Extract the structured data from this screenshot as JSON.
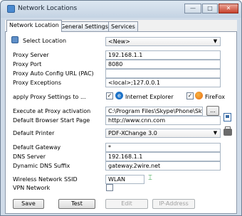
{
  "window": {
    "title": "Network Locations",
    "controls": [
      "—",
      "□",
      "✕"
    ]
  },
  "tabs": [
    "Network Location",
    "General Settings",
    "Services"
  ],
  "select_location": {
    "label": "Select Location",
    "value": "<New>"
  },
  "proxy": {
    "server_label": "Proxy Server",
    "server_value": "192.168.1.1",
    "port_label": "Proxy Port",
    "port_value": "8080",
    "pac_label": "Proxy Auto Config URL (PAC)",
    "pac_value": "",
    "exceptions_label": "Proxy Exceptions",
    "exceptions_value": "<local>;127.0.0.1"
  },
  "apply_proxy": {
    "label": "apply Proxy Settings to ...",
    "ie_label": "Internet Explorer",
    "ie_checked": true,
    "ff_label": "FireFox",
    "ff_checked": true
  },
  "execute": {
    "label": "Execute at Proxy activation",
    "value": "C:\\Program Files\\Skype\\Phone\\Skype.exe",
    "browse_label": "..."
  },
  "start_page": {
    "label": "Default Browser Start Page",
    "value": "http://www.cnn.com"
  },
  "printer": {
    "label": "Default Printer",
    "value": "PDF-XChange 3.0"
  },
  "gateway": {
    "label": "Default Gateway",
    "value": "*"
  },
  "dns": {
    "label": "DNS Server",
    "value": "192.168.1.1"
  },
  "dyn_dns": {
    "label": "Dynamic DNS Suffix",
    "value": "gateway.2wire.net"
  },
  "ssid": {
    "label": "Wireless Network SSID",
    "value": "WLAN"
  },
  "vpn": {
    "label": "VPN Network",
    "checked": false
  },
  "buttons": {
    "save": "Save",
    "test": "Test",
    "edit": "Edit",
    "ip": "IP-Address"
  },
  "colors": {
    "title_bar": "#c4d3e3",
    "close": "#c7402b",
    "ie_blue": "#1e73c8",
    "firefox_orange": "#e86a12"
  }
}
